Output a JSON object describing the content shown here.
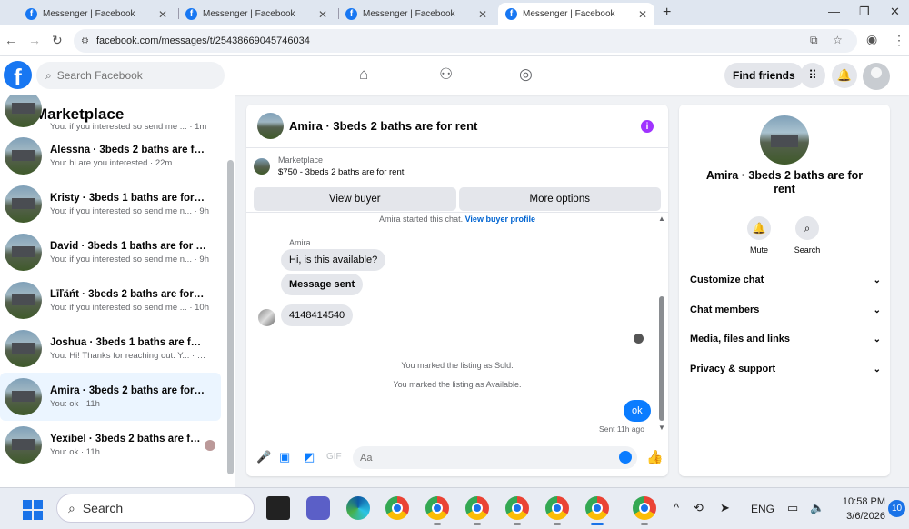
{
  "browser": {
    "tabs": [
      {
        "title": "Messenger | Facebook",
        "active": false
      },
      {
        "title": "Messenger | Facebook",
        "active": false
      },
      {
        "title": "Messenger | Facebook",
        "active": false
      },
      {
        "title": "Messenger | Facebook",
        "active": true
      }
    ],
    "url": "facebook.com/messages/t/25438669045746034"
  },
  "header": {
    "search_placeholder": "Search Facebook",
    "find_friends": "Find friends"
  },
  "left": {
    "title": "Marketplace",
    "conversations": [
      {
        "name": "",
        "snippet": "You: if you interested so send me ... · 1m",
        "selected": false,
        "partial": true
      },
      {
        "name": "Alessna · 3beds 2 baths are for r...",
        "snippet": "You: hi are you interested · 22m",
        "selected": false
      },
      {
        "name": "Kristy · 3beds 1 baths are for rent",
        "snippet": "You: if you interested so send me n... · 9h",
        "selected": false
      },
      {
        "name": "David · 3beds 1 baths are for rent",
        "snippet": "You: if you interested so send me n... · 9h",
        "selected": false
      },
      {
        "name": "Līľäńt · 3beds 2 baths are for rent",
        "snippet": "You: if you interested so send me ... · 10h",
        "selected": false
      },
      {
        "name": "Joshua · 3beds 1 baths are for rent",
        "snippet": "You: Hi! Thanks for reaching out. Y... · 11h",
        "selected": false
      },
      {
        "name": "Amira · 3beds 2 baths are for rent",
        "snippet": "You: ok · 11h",
        "selected": true
      },
      {
        "name": "Yexibel · 3beds 2 baths are for...",
        "snippet": "You: ok · 11h",
        "selected": false
      }
    ]
  },
  "chat": {
    "title": "Amira · 3beds 2 baths are for rent",
    "marketplace_label": "Marketplace",
    "listing": "$750 - 3beds 2 baths are for rent",
    "view_buyer": "View buyer",
    "more_options": "More options",
    "started_text": "Amira started this chat.",
    "view_buyer_profile": "View buyer profile",
    "sender": "Amira",
    "messages": [
      {
        "text": "Hi, is this available?"
      },
      {
        "text": "Message sent"
      },
      {
        "text": "4148414540"
      }
    ],
    "system_sold": "You marked the listing as Sold.",
    "system_available": "You marked the listing as Available.",
    "my_message": "ok",
    "sent_time": "Sent 11h ago",
    "composer_placeholder": "Aa"
  },
  "right": {
    "name": "Amira · 3beds 2 baths are for rent",
    "mute": "Mute",
    "search": "Search",
    "items": [
      "Customize chat",
      "Chat members",
      "Media, files and links",
      "Privacy & support"
    ]
  },
  "taskbar": {
    "search_label": "Search",
    "lang": "ENG",
    "time": "10:58 PM",
    "date": "3/6/2026",
    "notifications": "10"
  },
  "colors": {
    "brand": "#1877f2",
    "messenger_blue": "#0a7cff",
    "selected_row": "#ebf5ff"
  }
}
